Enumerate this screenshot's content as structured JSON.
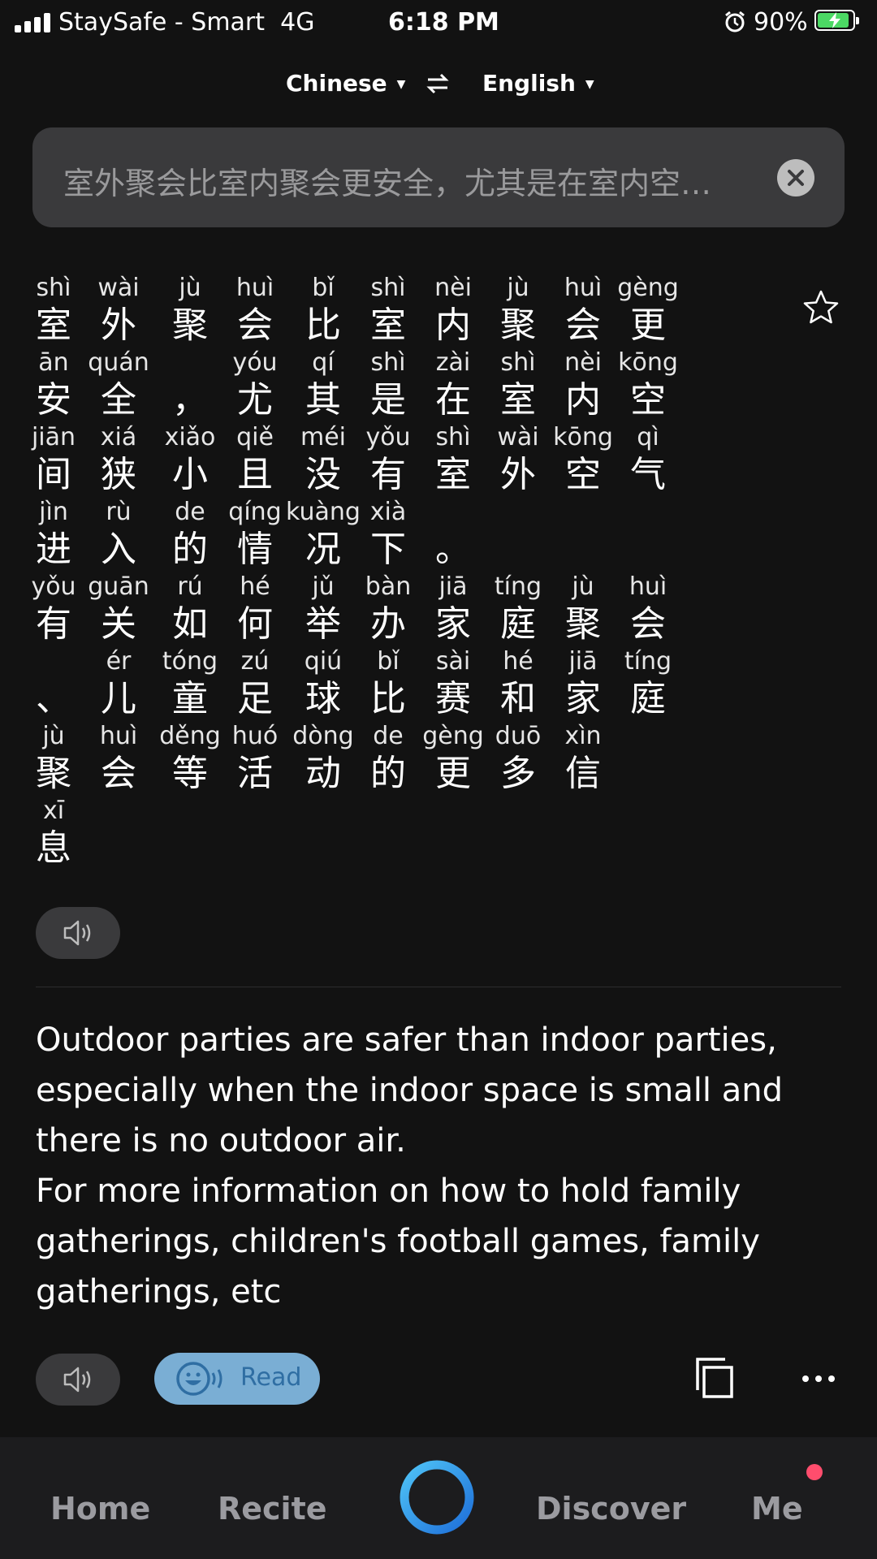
{
  "status_bar": {
    "carrier": "StaySafe - Smart",
    "network": "4G",
    "time": "6:18 PM",
    "battery": "90%",
    "battery_level": 0.9,
    "battery_color": "#4cd964"
  },
  "languages": {
    "source": "Chinese",
    "target": "English"
  },
  "source_input": {
    "text": "室外聚会比室内聚会更安全，尤其是在室内空…"
  },
  "pinyin_lines": [
    [
      {
        "py": "shì",
        "hz": "室"
      },
      {
        "py": "wài",
        "hz": "外"
      },
      {
        "py": "jù",
        "hz": "聚"
      },
      {
        "py": "huì",
        "hz": "会"
      },
      {
        "py": "bǐ",
        "hz": "比"
      },
      {
        "py": "shì",
        "hz": "室"
      },
      {
        "py": "nèi",
        "hz": "内"
      },
      {
        "py": "jù",
        "hz": "聚"
      },
      {
        "py": "huì",
        "hz": "会"
      },
      {
        "py": "gèng",
        "hz": "更"
      }
    ],
    [
      {
        "py": "ān",
        "hz": "安"
      },
      {
        "py": "quán",
        "hz": "全"
      },
      {
        "py": "",
        "hz": "，"
      },
      {
        "py": "yóu",
        "hz": "尤"
      },
      {
        "py": "qí",
        "hz": "其"
      },
      {
        "py": "shì",
        "hz": "是"
      },
      {
        "py": "zài",
        "hz": "在"
      },
      {
        "py": "shì",
        "hz": "室"
      },
      {
        "py": "nèi",
        "hz": "内"
      },
      {
        "py": "kōng",
        "hz": "空"
      }
    ],
    [
      {
        "py": "jiān",
        "hz": "间"
      },
      {
        "py": "xiá",
        "hz": "狭"
      },
      {
        "py": "xiǎo",
        "hz": "小"
      },
      {
        "py": "qiě",
        "hz": "且"
      },
      {
        "py": "méi",
        "hz": "没"
      },
      {
        "py": "yǒu",
        "hz": "有"
      },
      {
        "py": "shì",
        "hz": "室"
      },
      {
        "py": "wài",
        "hz": "外"
      },
      {
        "py": "kōng",
        "hz": "空"
      },
      {
        "py": "qì",
        "hz": "气"
      }
    ],
    [
      {
        "py": "jìn",
        "hz": "进"
      },
      {
        "py": "rù",
        "hz": "入"
      },
      {
        "py": "de",
        "hz": "的"
      },
      {
        "py": "qíng",
        "hz": "情"
      },
      {
        "py": "kuàng",
        "hz": "况"
      },
      {
        "py": "xià",
        "hz": "下"
      },
      {
        "py": "",
        "hz": "。"
      }
    ],
    [
      {
        "py": "yǒu",
        "hz": "有"
      },
      {
        "py": "guān",
        "hz": "关"
      },
      {
        "py": "rú",
        "hz": "如"
      },
      {
        "py": "hé",
        "hz": "何"
      },
      {
        "py": "jǔ",
        "hz": "举"
      },
      {
        "py": "bàn",
        "hz": "办"
      },
      {
        "py": "jiā",
        "hz": "家"
      },
      {
        "py": "tíng",
        "hz": "庭"
      },
      {
        "py": "jù",
        "hz": "聚"
      },
      {
        "py": "huì",
        "hz": "会"
      }
    ],
    [
      {
        "py": "",
        "hz": "、"
      },
      {
        "py": "ér",
        "hz": "儿"
      },
      {
        "py": "tóng",
        "hz": "童"
      },
      {
        "py": "zú",
        "hz": "足"
      },
      {
        "py": "qiú",
        "hz": "球"
      },
      {
        "py": "bǐ",
        "hz": "比"
      },
      {
        "py": "sài",
        "hz": "赛"
      },
      {
        "py": "hé",
        "hz": "和"
      },
      {
        "py": "jiā",
        "hz": "家"
      },
      {
        "py": "tíng",
        "hz": "庭"
      }
    ],
    [
      {
        "py": "jù",
        "hz": "聚"
      },
      {
        "py": "huì",
        "hz": "会"
      },
      {
        "py": "děng",
        "hz": "等"
      },
      {
        "py": "huó",
        "hz": "活"
      },
      {
        "py": "dòng",
        "hz": "动"
      },
      {
        "py": "de",
        "hz": "的"
      },
      {
        "py": "gèng",
        "hz": "更"
      },
      {
        "py": "duō",
        "hz": "多"
      },
      {
        "py": "xìn",
        "hz": "信"
      }
    ],
    [
      {
        "py": "xī",
        "hz": "息"
      }
    ]
  ],
  "translation": {
    "paragraph_1": "Outdoor parties are safer than indoor parties, especially when the indoor space is small and there is no outdoor air.",
    "paragraph_2": "For more information on how to hold family gatherings, children's football games, family gatherings, etc"
  },
  "actions": {
    "read_label": "Read"
  },
  "nav": {
    "home": "Home",
    "recite": "Recite",
    "discover": "Discover",
    "me": "Me",
    "badge_color": "#ff4d6d",
    "assistant_color": "#2f8fe6"
  }
}
